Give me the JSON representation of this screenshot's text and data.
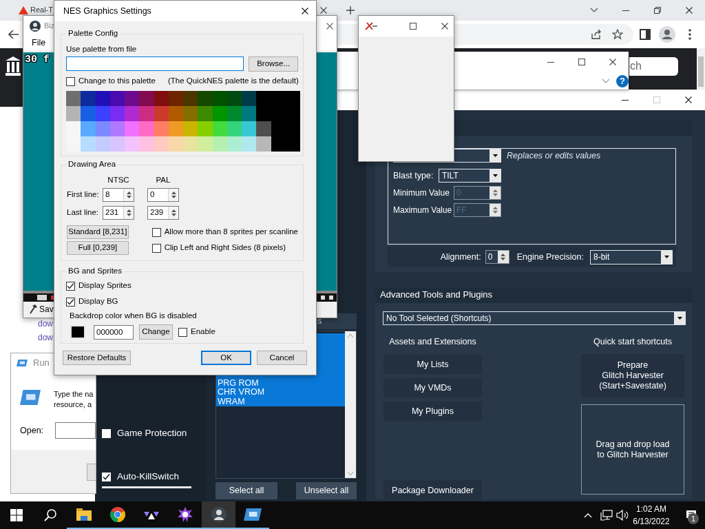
{
  "browser": {
    "tab_title": "Real-T",
    "search_text": "ch",
    "links": [
      "dow",
      "dow"
    ]
  },
  "emulator": {
    "title": "Biz",
    "menu": [
      "File"
    ],
    "osd": "30 f",
    "status": "Sav"
  },
  "help_window": {
    "help": "?"
  },
  "run_dialog": {
    "title": "Run",
    "message": [
      "Type the na",
      "resource, a"
    ],
    "open_label": "Open:"
  },
  "rtc": {
    "group": {
      "hint": "Replaces or edits values",
      "fields": [
        {
          "kind": "dropdown",
          "label": "Blast type:",
          "value": "TILT",
          "disabled": false
        },
        {
          "kind": "spin",
          "label": "Minimum Value",
          "value": "0",
          "disabled": true
        },
        {
          "kind": "spin",
          "label": "Maximum Value",
          "value": "FF",
          "disabled": true
        }
      ]
    },
    "alignment": {
      "label": "Alignment:",
      "value": "0"
    },
    "precision": {
      "label": "Engine Precision:",
      "value": "8-bit"
    },
    "options": [
      {
        "label": "Game Protection",
        "checked": false
      },
      {
        "label": "Auto-KillSwitch",
        "checked": true
      }
    ],
    "domains_tab": "s",
    "domains": [
      {
        "label": "PRG ROM",
        "selected": true
      },
      {
        "label": "CHR VROM",
        "selected": true
      },
      {
        "label": "WRAM",
        "selected": true
      }
    ],
    "domain_buttons": [
      "Select all",
      "Unselect all"
    ],
    "advanced": {
      "title": "Advanced Tools and Plugins",
      "tool": "No Tool Selected (Shortcuts)",
      "assets_title": "Assets and Extensions",
      "assets": [
        "My Lists",
        "My VMDs",
        "My Plugins"
      ],
      "downloader": "Package Downloader",
      "shortcuts_title": "Quick start shortcuts",
      "harvester": [
        "Prepare",
        "Glitch Harvester",
        "(Start+Savestate)"
      ],
      "drop_zone": [
        "Drag and drop load",
        "to Glitch Harvester"
      ]
    }
  },
  "nes_dialog": {
    "title": "NES Graphics Settings",
    "palette_config": {
      "legend": "Palette Config",
      "file_label": "Use palette from file",
      "browse": "Browse...",
      "change_palette": {
        "label": "Change to this palette",
        "checked": false
      },
      "note": "(The QuickNES palette is the default)",
      "palette": [
        {
          "swatches": [
            {
              "color": "#6e6e6e"
            },
            {
              "color": "#0e2a9c"
            },
            {
              "color": "#2010b6"
            },
            {
              "color": "#4a0aae"
            },
            {
              "color": "#6e0a8c"
            },
            {
              "color": "#820a4e"
            },
            {
              "color": "#800e0e"
            },
            {
              "color": "#6e2400"
            },
            {
              "color": "#4c3600"
            },
            {
              "color": "#144a00"
            },
            {
              "color": "#005200"
            },
            {
              "color": "#004c10"
            },
            {
              "color": "#003c48"
            },
            {
              "color": "#000000"
            },
            {
              "color": "#000000"
            },
            {
              "color": "#000000"
            }
          ]
        },
        {
          "swatches": [
            {
              "color": "#b4b4b4"
            },
            {
              "color": "#1660e6"
            },
            {
              "color": "#3c40ff"
            },
            {
              "color": "#7a2cf2"
            },
            {
              "color": "#b02ad0"
            },
            {
              "color": "#cc2c82"
            },
            {
              "color": "#cc3a2a"
            },
            {
              "color": "#b05a00"
            },
            {
              "color": "#846e00"
            },
            {
              "color": "#3c8a00"
            },
            {
              "color": "#009600"
            },
            {
              "color": "#00882e"
            },
            {
              "color": "#007882"
            },
            {
              "color": "#000000"
            },
            {
              "color": "#000000"
            },
            {
              "color": "#000000"
            }
          ]
        },
        {
          "swatches": [
            {
              "color": "#f6f6f6"
            },
            {
              "color": "#58aaff"
            },
            {
              "color": "#7a8aff"
            },
            {
              "color": "#b078ff"
            },
            {
              "color": "#f070ff"
            },
            {
              "color": "#ff6ac4"
            },
            {
              "color": "#ff7e64"
            },
            {
              "color": "#f09a26"
            },
            {
              "color": "#c8b600"
            },
            {
              "color": "#86d000"
            },
            {
              "color": "#44dc3c"
            },
            {
              "color": "#32d47c"
            },
            {
              "color": "#38c8d4"
            },
            {
              "color": "#4e4e4e"
            },
            {
              "color": "#000000"
            },
            {
              "color": "#000000"
            }
          ]
        },
        {
          "swatches": [
            {
              "color": "#f6f6f6"
            },
            {
              "color": "#b6dcff"
            },
            {
              "color": "#c4ccff"
            },
            {
              "color": "#dac4ff"
            },
            {
              "color": "#f4c2ff"
            },
            {
              "color": "#ffc0e2"
            },
            {
              "color": "#ffcac0"
            },
            {
              "color": "#f8d8a8"
            },
            {
              "color": "#e8e4a0"
            },
            {
              "color": "#d0ee9c"
            },
            {
              "color": "#b6f0b0"
            },
            {
              "color": "#aceed0"
            },
            {
              "color": "#b0e8f0"
            },
            {
              "color": "#b8b8b8"
            },
            {
              "color": "#000000"
            },
            {
              "color": "#000000"
            }
          ]
        }
      ]
    },
    "drawing_area": {
      "legend": "Drawing Area",
      "columns": [
        "NTSC",
        "PAL"
      ],
      "rows": [
        {
          "label": "First line:",
          "values": [
            "8",
            "0"
          ]
        },
        {
          "label": "Last line:",
          "values": [
            "231",
            "239"
          ]
        }
      ],
      "presets": [
        "Standard [8,231]",
        "Full [0,239]"
      ],
      "options": [
        {
          "label": "Allow more than 8 sprites per scanline",
          "checked": false
        },
        {
          "label": "Clip Left and Right Sides (8 pixels)",
          "checked": false
        }
      ]
    },
    "bg_sprites": {
      "legend": "BG and Sprites",
      "options": [
        {
          "label": "Display Sprites",
          "checked": true
        },
        {
          "label": "Display BG",
          "checked": true
        }
      ],
      "backdrop_label": "Backdrop color when BG is disabled",
      "backdrop": {
        "color": "#000000"
      },
      "backdrop_value": "000000",
      "change": "Change",
      "enable": {
        "label": "Enable",
        "checked": false
      }
    },
    "buttons": [
      {
        "label": "Restore Defaults",
        "default": false
      },
      {
        "label": "OK",
        "default": true
      },
      {
        "label": "Cancel",
        "default": false
      }
    ]
  },
  "taskbar": {
    "apps": [
      {
        "kind": "explorer",
        "selected": false
      },
      {
        "kind": "chrome",
        "selected": false
      },
      {
        "kind": "triangles",
        "selected": false
      },
      {
        "kind": "star",
        "selected": false
      },
      {
        "kind": "emulator",
        "selected": true
      },
      {
        "kind": "run",
        "selected": false
      }
    ],
    "time": "1:02 AM",
    "date": "6/13/2022",
    "notifications": "1"
  }
}
